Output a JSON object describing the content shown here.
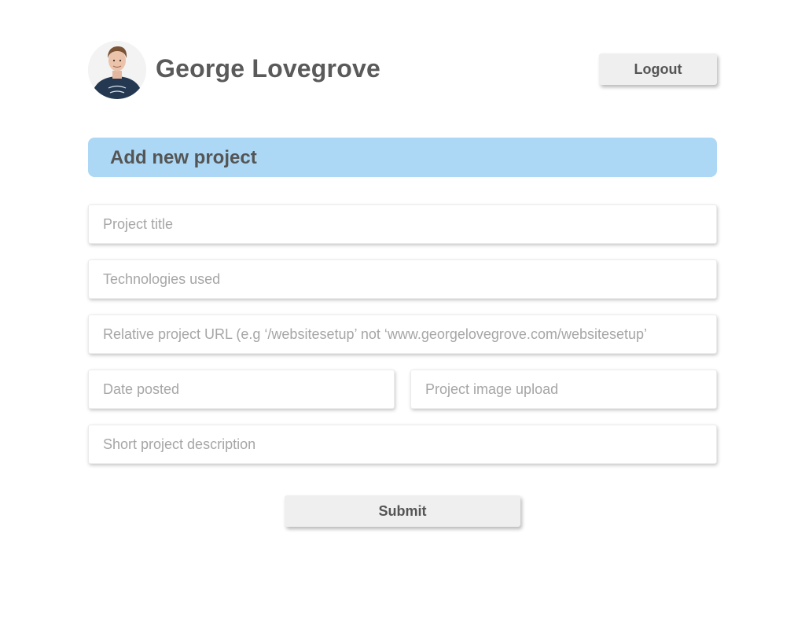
{
  "header": {
    "user_name": "George Lovegrove",
    "avatar_icon": "user-avatar",
    "logout_label": "Logout"
  },
  "form": {
    "section_title": "Add new project",
    "fields": {
      "project_title": {
        "value": "",
        "placeholder": "Project title"
      },
      "technologies_used": {
        "value": "",
        "placeholder": "Technologies used"
      },
      "relative_url": {
        "value": "",
        "placeholder": "Relative project URL (e.g ‘/websitesetup’ not ‘www.georgelovegrove.com/websitesetup’"
      },
      "date_posted": {
        "value": "",
        "placeholder": "Date posted"
      },
      "image_upload": {
        "value": "",
        "placeholder": "Project image upload"
      },
      "short_description": {
        "value": "",
        "placeholder": "Short project description"
      }
    },
    "submit_label": "Submit"
  },
  "colors": {
    "banner": "#acd8f5",
    "button": "#efefef",
    "text": "#555555",
    "placeholder": "#a6a6a6"
  }
}
